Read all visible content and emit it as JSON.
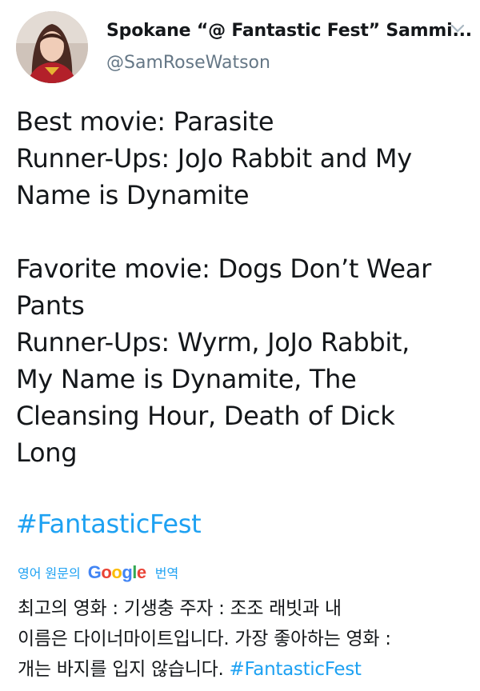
{
  "header": {
    "display_name": "Spokane “@ Fantastic Fest” Sammi...",
    "handle": "@SamRoseWatson"
  },
  "tweet": {
    "lines_block1": [
      "Best movie: Parasite",
      "Runner-Ups: JoJo Rabbit and My",
      "Name is Dynamite"
    ],
    "lines_block2": [
      "Favorite movie: Dogs Don’t Wear",
      "Pants",
      "Runner-Ups: Wyrm, JoJo Rabbit,",
      "My Name is Dynamite, The",
      "Cleansing Hour, Death of Dick",
      "Long"
    ],
    "hashtag": "#FantasticFest"
  },
  "translation": {
    "prefix": "영어 원문의",
    "google_letters": [
      "G",
      "o",
      "o",
      "g",
      "l",
      "e"
    ],
    "suffix": "번역",
    "lines": [
      "최고의 영화 : 기생충 주자 : 조조 래빗과 내",
      "이름은 다이너마이트입니다. 가장 좋아하는 영화 :",
      "개는 바지를 입지 않습니다. "
    ],
    "hashtag": "#FantasticFest"
  },
  "colors": {
    "link": "#1da1f2",
    "text": "#14171a",
    "secondary": "#657786"
  },
  "icons": {
    "menu": "chevron-down-icon"
  }
}
